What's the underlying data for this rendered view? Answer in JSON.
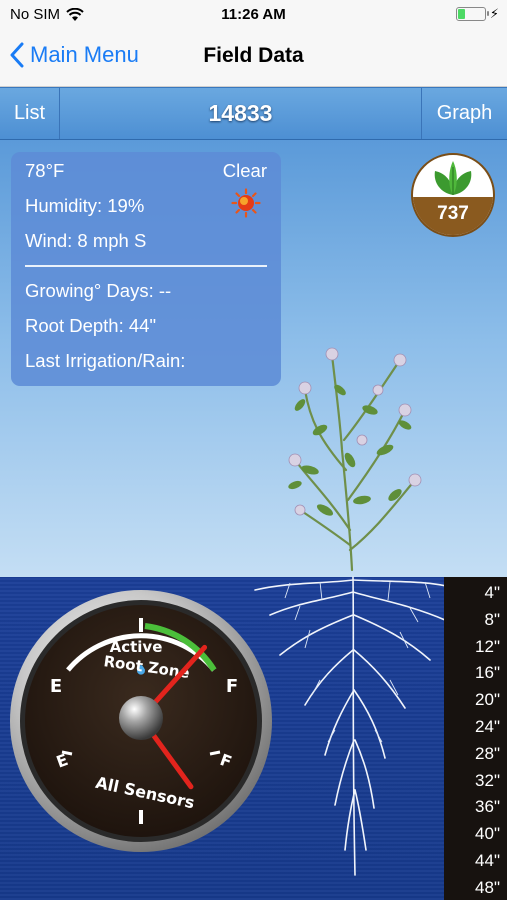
{
  "status": {
    "carrier": "No SIM",
    "time": "11:26 AM",
    "battery_level": 0.25
  },
  "nav": {
    "back_label": "Main Menu",
    "title": "Field Data"
  },
  "toolbar": {
    "list_label": "List",
    "id": "14833",
    "graph_label": "Graph"
  },
  "weather": {
    "temperature": "78°F",
    "condition": "Clear",
    "humidity": "Humidity: 19%",
    "wind": "Wind: 8 mph S",
    "growing_days": "Growing° Days: --",
    "root_depth": "Root Depth: 44\"",
    "last_irrigation": "Last Irrigation/Rain:"
  },
  "badge": {
    "value": "737"
  },
  "gauge": {
    "title_line1": "Active",
    "title_line2": "Root Zone",
    "bottom_label": "All Sensors",
    "empty_label": "E",
    "full_label": "F",
    "upper_needle_level": 0.88,
    "lower_needle_level": 0.9
  },
  "depth_scale": [
    "4\"",
    "8\"",
    "12\"",
    "16\"",
    "20\"",
    "24\"",
    "28\"",
    "32\"",
    "36\"",
    "40\"",
    "44\"",
    "48\""
  ],
  "colors": {
    "accent_blue": "#1a7cf5",
    "toolbar": "#5b9bd9",
    "soil": "#1b3e98",
    "gauge_green": "#4bbf3a",
    "needle_red": "#e2241d",
    "badge_brown": "#8a5a1f"
  }
}
